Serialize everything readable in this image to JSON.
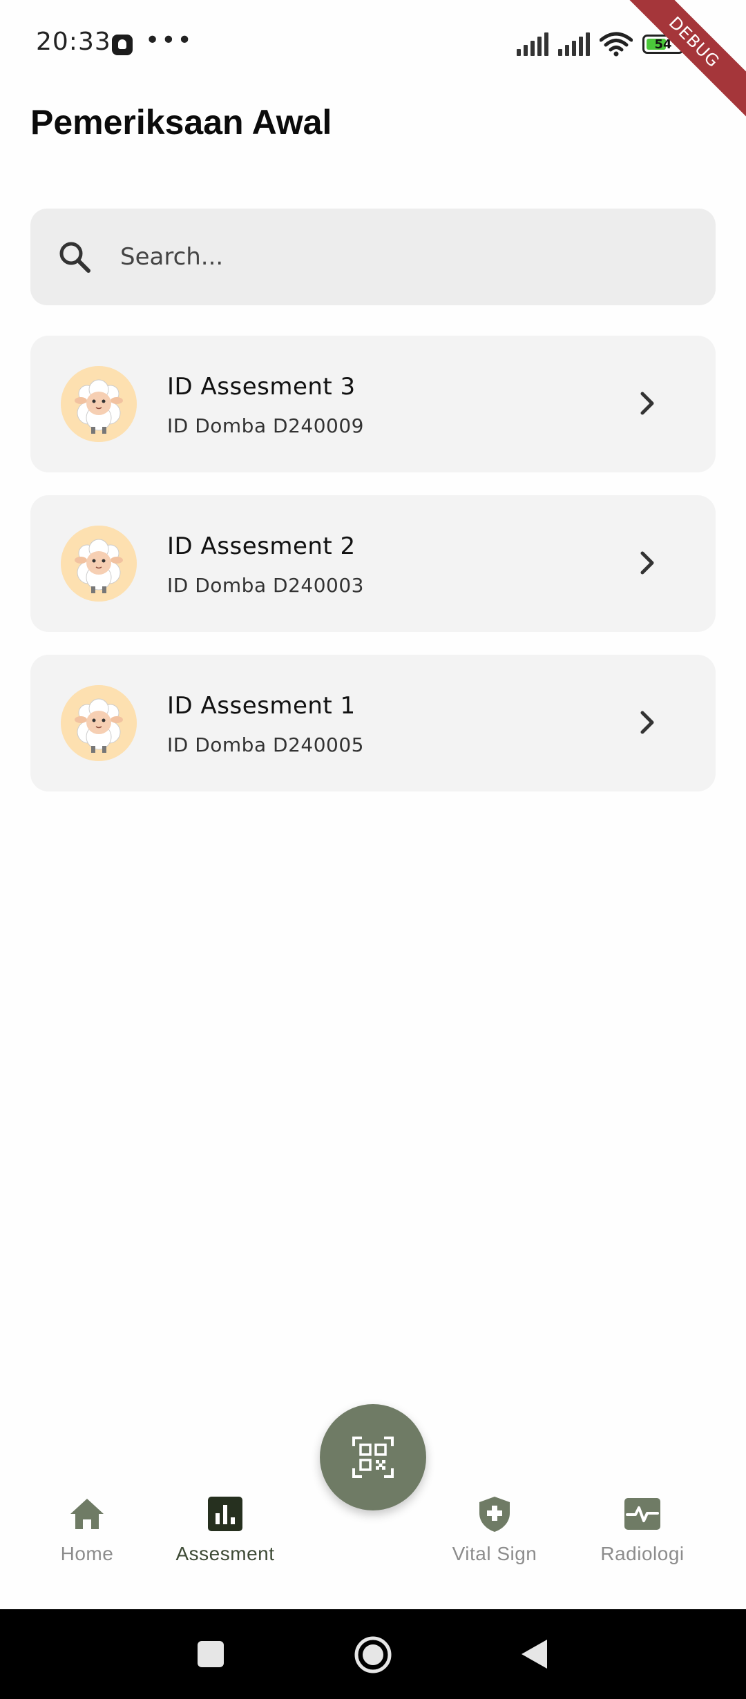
{
  "status_bar": {
    "time": "20:33",
    "more": "•••",
    "battery_level": "54",
    "icons": [
      "app-notification-icon",
      "signal-icon",
      "signal-icon",
      "wifi-icon",
      "battery-icon"
    ]
  },
  "debug_banner": "DEBUG",
  "page": {
    "title": "Pemeriksaan Awal"
  },
  "search": {
    "placeholder": "Search...",
    "value": ""
  },
  "assessments": [
    {
      "title": "ID Assesment 3",
      "subtitle": "ID Domba D240009"
    },
    {
      "title": "ID Assesment 2",
      "subtitle": "ID Domba D240003"
    },
    {
      "title": "ID Assesment 1",
      "subtitle": "ID Domba D240005"
    }
  ],
  "bottom_nav": {
    "items": [
      {
        "label": "Home",
        "icon": "home-icon",
        "active": false
      },
      {
        "label": "Assesment",
        "icon": "bar-chart-icon",
        "active": true
      },
      {
        "label": "Vital Sign",
        "icon": "shield-plus-icon",
        "active": false
      },
      {
        "label": "Radiologi",
        "icon": "pulse-monitor-icon",
        "active": false
      }
    ],
    "fab_icon": "qr-code-scan-icon"
  },
  "colors": {
    "accent": "#6f7b65",
    "active_nav": "#3d4a35",
    "inactive_nav": "#8c8c8c",
    "card_bg": "#f3f3f3",
    "avatar_bg": "#fde0b0",
    "debug_ribbon": "#a5363a"
  }
}
